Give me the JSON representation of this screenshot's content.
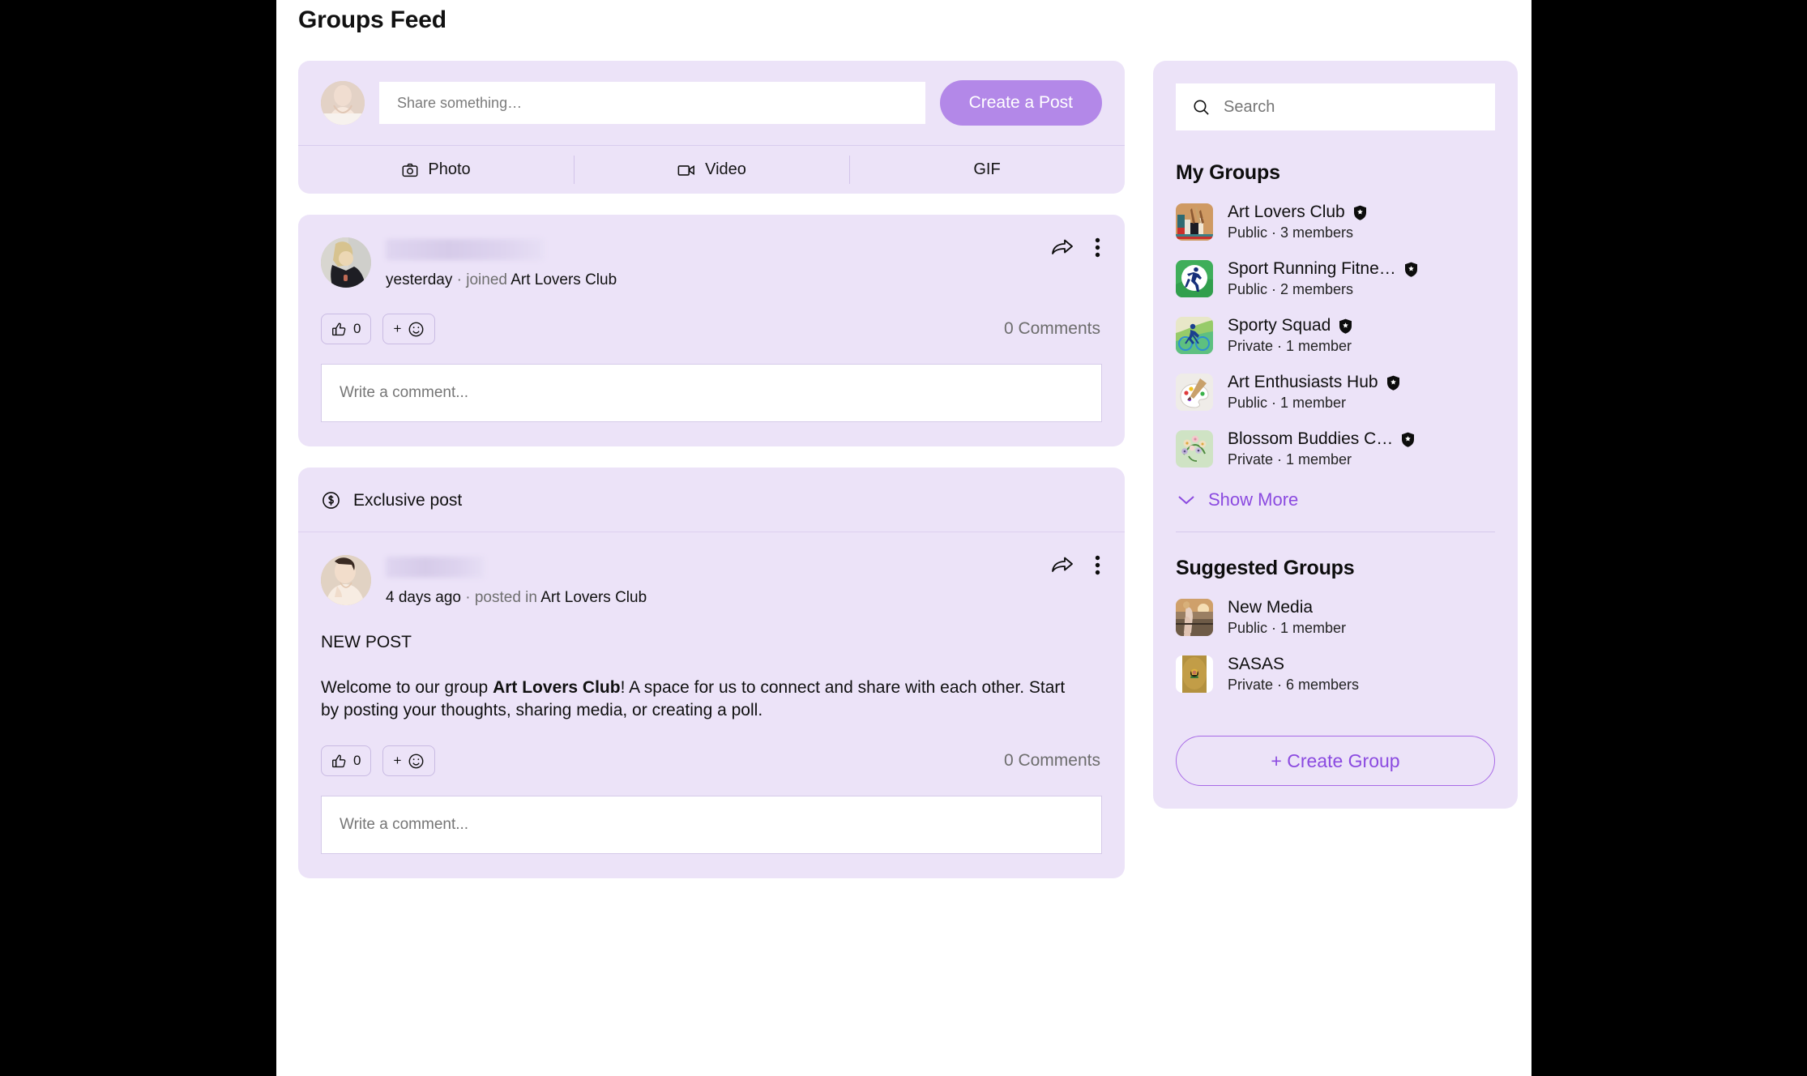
{
  "page": {
    "title": "Groups Feed"
  },
  "composer": {
    "share_placeholder": "Share something…",
    "create_post_label": "Create a Post",
    "actions": [
      {
        "label": "Photo",
        "icon": "camera-icon"
      },
      {
        "label": "Video",
        "icon": "video-camera-icon"
      },
      {
        "label": "GIF",
        "icon": ""
      }
    ]
  },
  "posts": [
    {
      "exclusive": false,
      "exclusive_label": "",
      "time": "yesterday",
      "separator": "·",
      "action": "joined",
      "group": "Art Lovers Club",
      "title": "",
      "text_before": "",
      "text_bold": "",
      "text_after": "",
      "like_count": "0",
      "add_reaction": "+",
      "comments_label": "0 Comments",
      "comment_placeholder": "Write a comment..."
    },
    {
      "exclusive": true,
      "exclusive_label": "Exclusive post",
      "time": "4 days ago",
      "separator": "·",
      "action": "posted in",
      "group": "Art Lovers Club",
      "title": "NEW POST",
      "text_before": "Welcome to our group ",
      "text_bold": "Art Lovers Club",
      "text_after": "! A space for us to connect and share with each other. Start by posting your thoughts, sharing media, or creating a poll.",
      "like_count": "0",
      "add_reaction": "+",
      "comments_label": "0 Comments",
      "comment_placeholder": "Write a comment..."
    }
  ],
  "sidebar": {
    "search_placeholder": "Search",
    "my_groups_heading": "My Groups",
    "my_groups": [
      {
        "name": "Art Lovers Club",
        "meta": "Public · 3 members",
        "verified": true,
        "thumb": "art-supplies-thumb"
      },
      {
        "name": "Sport Running Fitne…",
        "meta": "Public · 2 members",
        "verified": true,
        "thumb": "runner-thumb"
      },
      {
        "name": "Sporty Squad",
        "meta": "Private · 1 member",
        "verified": true,
        "thumb": "cyclist-thumb"
      },
      {
        "name": "Art Enthusiasts Hub",
        "meta": "Public · 1 member",
        "verified": true,
        "thumb": "palette-thumb"
      },
      {
        "name": "Blossom Buddies C…",
        "meta": "Private · 1 member",
        "verified": true,
        "thumb": "flowers-thumb"
      }
    ],
    "show_more_label": "Show More",
    "suggested_heading": "Suggested Groups",
    "suggested_groups": [
      {
        "name": "New Media",
        "meta": "Public · 1 member",
        "verified": false,
        "thumb": "sunset-photo-thumb"
      },
      {
        "name": "SASAS",
        "meta": "Private · 6 members",
        "verified": false,
        "thumb": "portrait-thumb"
      }
    ],
    "create_group_label": "+ Create Group"
  },
  "colors": {
    "card_bg": "#ece3f8",
    "accent_purple": "#8b4ae0",
    "button_purple": "#b388e8",
    "page_bg": "#ffffff",
    "letterbox": "#000000"
  }
}
